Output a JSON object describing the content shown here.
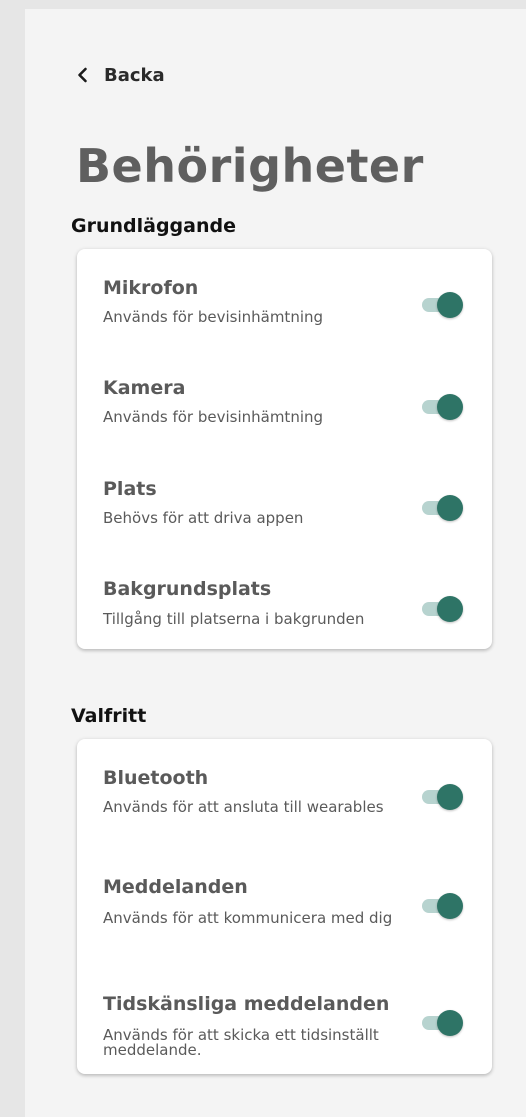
{
  "nav": {
    "back_label": "Backa",
    "back_icon": "chevron-left-icon"
  },
  "page": {
    "title": "Behörigheter"
  },
  "colors": {
    "toggle_on_knob": "#2e7466",
    "toggle_on_track": "#b7d3cf",
    "background": "#f4f4f4",
    "card": "#ffffff"
  },
  "sections": [
    {
      "title": "Grundläggande",
      "items": [
        {
          "title": "Mikrofon",
          "description": "Används för bevisinhämtning",
          "enabled": true
        },
        {
          "title": "Kamera",
          "description": "Används för bevisinhämtning",
          "enabled": true
        },
        {
          "title": "Plats",
          "description": "Behövs för att driva appen",
          "enabled": true
        },
        {
          "title": "Bakgrundsplats",
          "description": "Tillgång till platserna i bakgrunden",
          "enabled": true
        }
      ]
    },
    {
      "title": "Valfritt",
      "items": [
        {
          "title": "Bluetooth",
          "description": "Används för att ansluta till wearables",
          "enabled": true
        },
        {
          "title": "Meddelanden",
          "description": "Används för att kommunicera med dig",
          "enabled": true
        },
        {
          "title": "Tidskänsliga meddelanden",
          "description": "Används för att skicka ett tidsinställt meddelande.",
          "enabled": true
        }
      ]
    }
  ]
}
